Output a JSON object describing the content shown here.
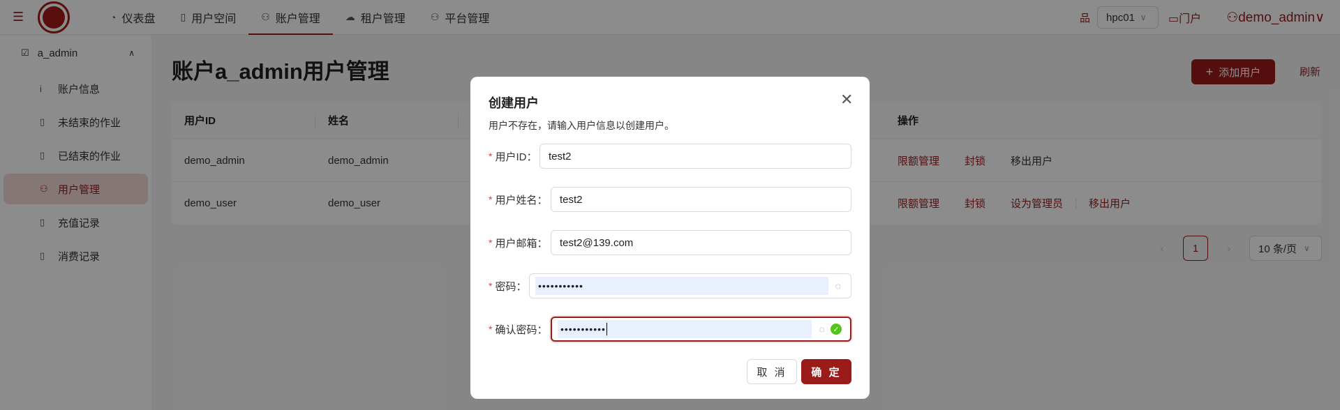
{
  "header": {
    "nav": [
      {
        "label": "仪表盘",
        "icon": "dashboard-icon"
      },
      {
        "label": "用户空间",
        "icon": "book-icon"
      },
      {
        "label": "账户管理",
        "icon": "user-icon"
      },
      {
        "label": "租户管理",
        "icon": "cloud-icon"
      },
      {
        "label": "平台管理",
        "icon": "user-icon"
      }
    ],
    "active_nav": "账户管理",
    "cluster": "hpc01",
    "portal": "门户",
    "user": "demo_admin"
  },
  "sidebar": {
    "group": "a_admin",
    "items": [
      {
        "label": "账户信息"
      },
      {
        "label": "未结束的作业"
      },
      {
        "label": "已结束的作业"
      },
      {
        "label": "用户管理"
      },
      {
        "label": "充值记录"
      },
      {
        "label": "消费记录"
      }
    ],
    "active": "用户管理"
  },
  "main": {
    "title": "账户a_admin用户管理",
    "add_button": "添加用户",
    "refresh": "刷新",
    "table": {
      "headers": [
        "用户ID",
        "姓名",
        "操作"
      ],
      "rows": [
        {
          "id": "demo_admin",
          "name": "demo_admin",
          "ops": [
            "限额管理",
            "封锁",
            "移出用户"
          ]
        },
        {
          "id": "demo_user",
          "name": "demo_user",
          "ops": [
            "限额管理",
            "封锁",
            "设为管理员",
            "移出用户"
          ]
        }
      ]
    },
    "pagination": {
      "current_page": "1",
      "page_size": "10 条/页"
    }
  },
  "modal": {
    "title": "创建用户",
    "description": "用户不存在，请输入用户信息以创建用户。",
    "fields": {
      "user_id": {
        "label": "用户ID",
        "value": "test2"
      },
      "user_name": {
        "label": "用户姓名",
        "value": "test2"
      },
      "email": {
        "label": "用户邮箱",
        "value": "test2@139.com"
      },
      "password": {
        "label": "密码",
        "value": "•••••••••••"
      },
      "confirm_password": {
        "label": "确认密码",
        "value": "•••••••••••"
      }
    },
    "cancel": "取 消",
    "confirm": "确 定"
  },
  "colors": {
    "brand": "#9b1b1b",
    "success": "#52c41a",
    "required": "#e23a3a"
  }
}
